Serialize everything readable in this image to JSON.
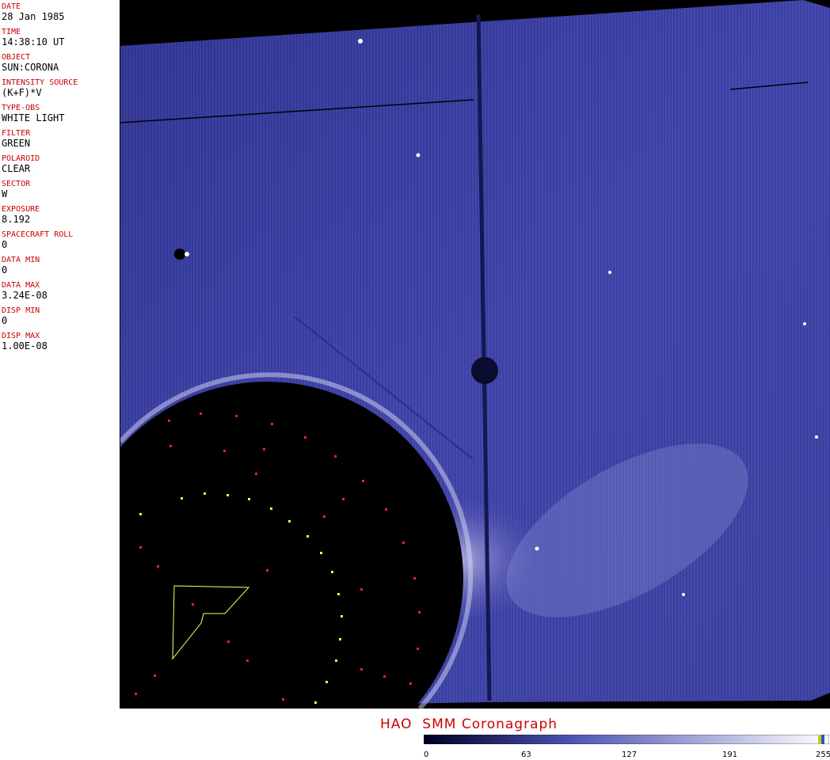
{
  "metadata": {
    "fields": [
      {
        "label": "DATE",
        "value": "28 Jan 1985"
      },
      {
        "label": "TIME",
        "value": "14:38:10 UT"
      },
      {
        "label": "OBJECT",
        "value": "SUN:CORONA"
      },
      {
        "label": "INTENSITY SOURCE",
        "value": "(K+F)*V"
      },
      {
        "label": "TYPE-OBS",
        "value": "WHITE LIGHT"
      },
      {
        "label": "FILTER",
        "value": "GREEN"
      },
      {
        "label": "POLAROID",
        "value": "CLEAR"
      },
      {
        "label": "SECTOR",
        "value": "W"
      },
      {
        "label": "EXPOSURE",
        "value": "8.192"
      },
      {
        "label": "SPACECRAFT ROLL",
        "value": "0"
      },
      {
        "label": "DATA MIN",
        "value": "0"
      },
      {
        "label": "DATA MAX",
        "value": "3.24E-08"
      },
      {
        "label": "DISP MIN",
        "value": "0"
      },
      {
        "label": "DISP MAX",
        "value": "1.00E-08"
      }
    ]
  },
  "title": "HAO  SMM Coronagraph",
  "colorbar": {
    "ticks": [
      "0",
      "63",
      "127",
      "191",
      "255"
    ],
    "colors": {
      "dark": "#000022",
      "mid": "#4a50b0",
      "light": "#ffffff"
    }
  },
  "colors": {
    "label": "#cc0000",
    "corona": "#3a3fa0",
    "occulter": "#000000"
  }
}
